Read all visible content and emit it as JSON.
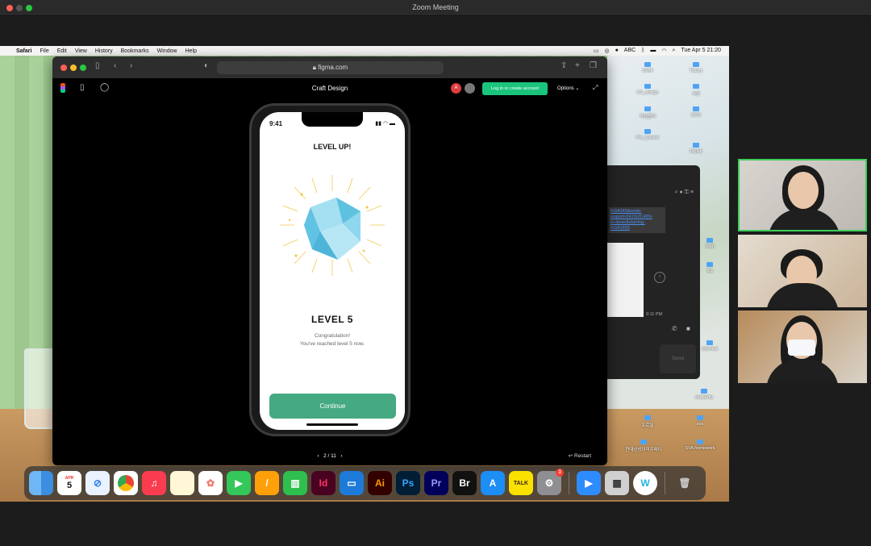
{
  "zoom": {
    "title": "Zoom Meeting"
  },
  "menubar": {
    "app": "Safari",
    "items": [
      "File",
      "Edit",
      "View",
      "History",
      "Bookmarks",
      "Window",
      "Help"
    ],
    "clock": "Tue Apr 5  21:20",
    "abc": "ABC"
  },
  "safari": {
    "url": "figma.com"
  },
  "figma": {
    "title": "Craft Design",
    "avatar_letter": "A",
    "login_label": "Log in or create account",
    "options_label": "Options",
    "pager": "2 / 11",
    "restart": "Restart"
  },
  "phone": {
    "time": "9:41",
    "heading": "LEVEL UP!",
    "level": "LEVEL 5",
    "congrats_line1": "Congratulation!",
    "congrats_line2": "You've reached level 5 now.",
    "button": "Continue"
  },
  "chat": {
    "link_text": "%3A240&node-\nwsport=241%2C48%\nle-down&starting-\n%3A1659",
    "time": "9:11 PM",
    "send": "Send"
  },
  "desktop_icons": [
    "SVA#",
    "Tistory",
    "UX_design",
    "사진",
    "작업폴더",
    "2023",
    "Pro_Career",
    "Digital",
    "Toefl",
    "Al",
    "dig",
    "Thesis",
    "Inforreal",
    "shutterfly",
    "sva",
    "SVA homework",
    "프로필",
    "현대상성이미지매니"
  ],
  "dock": {
    "calendar_month": "APR",
    "calendar_day": "5",
    "apps": [
      {
        "name": "finder",
        "label": ""
      },
      {
        "name": "calendar",
        "label": ""
      },
      {
        "name": "safari",
        "label": ""
      },
      {
        "name": "chrome",
        "label": ""
      },
      {
        "name": "music",
        "label": ""
      },
      {
        "name": "notes",
        "label": ""
      },
      {
        "name": "photos",
        "label": ""
      },
      {
        "name": "facetime",
        "label": ""
      },
      {
        "name": "pages",
        "label": ""
      },
      {
        "name": "numbers",
        "label": ""
      },
      {
        "name": "indesign",
        "label": "Id"
      },
      {
        "name": "keynote",
        "label": ""
      },
      {
        "name": "illustrator",
        "label": "Ai"
      },
      {
        "name": "photoshop",
        "label": "Ps"
      },
      {
        "name": "premiere",
        "label": "Pr"
      },
      {
        "name": "bridge",
        "label": "Br"
      },
      {
        "name": "appstore",
        "label": ""
      },
      {
        "name": "kakaotalk",
        "label": "TALK"
      },
      {
        "name": "settings",
        "label": ""
      },
      {
        "name": "zoom",
        "label": ""
      },
      {
        "name": "calculator",
        "label": ""
      },
      {
        "name": "w-app",
        "label": "W"
      },
      {
        "name": "trash",
        "label": ""
      }
    ],
    "settings_badge": "3"
  },
  "colors": {
    "figma_green": "#1bc47d",
    "continue_green": "#45a982",
    "active_speaker": "#3dce5a"
  }
}
